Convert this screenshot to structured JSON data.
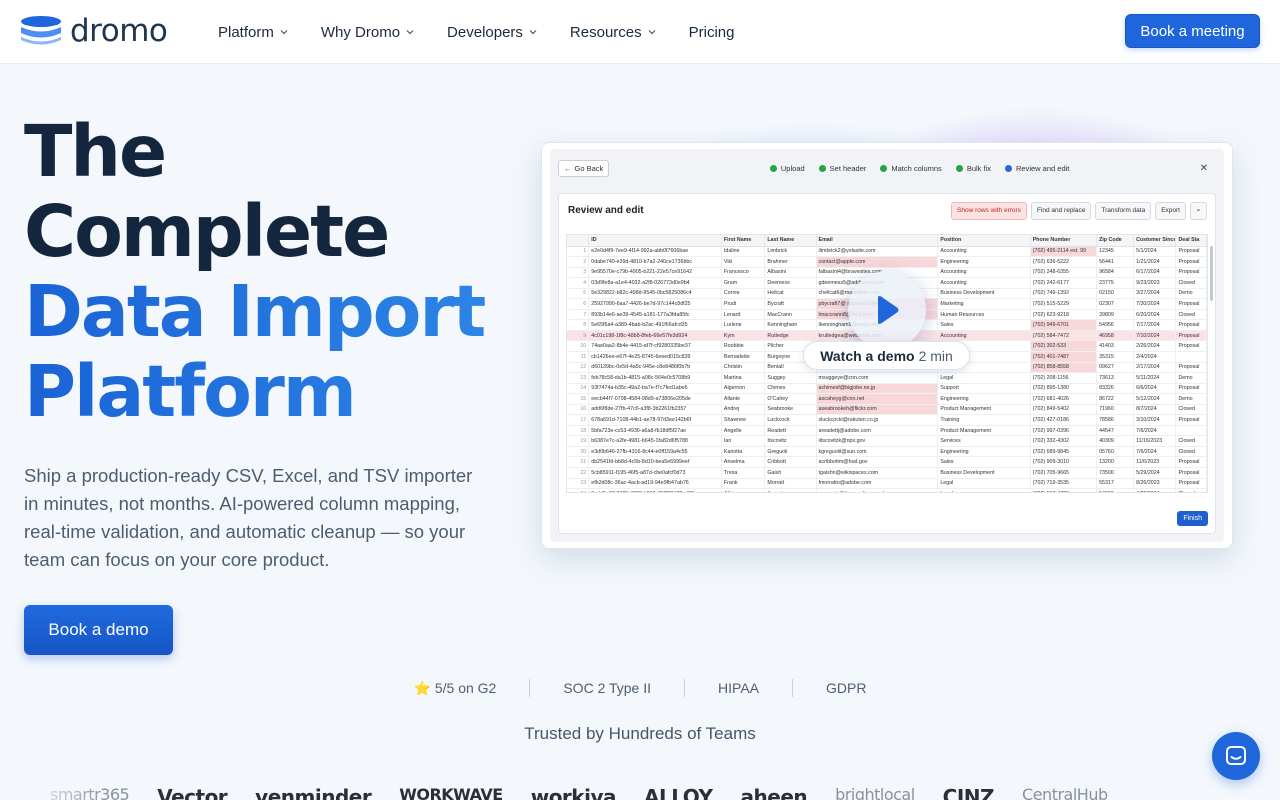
{
  "brand": {
    "name": "dromo"
  },
  "nav": {
    "items": [
      {
        "label": "Platform",
        "has_menu": true
      },
      {
        "label": "Why Dromo",
        "has_menu": true
      },
      {
        "label": "Developers",
        "has_menu": true
      },
      {
        "label": "Resources",
        "has_menu": true
      },
      {
        "label": "Pricing",
        "has_menu": false
      }
    ],
    "cta_label": "Book a meeting"
  },
  "hero": {
    "title_line1": "The",
    "title_line2": "Complete",
    "title_line3": "Data Import",
    "title_line4": "Platform",
    "subtitle": "Ship a production-ready CSV, Excel, and TSV importer in minutes, not months. AI-powered column mapping, real-time validation, and automatic cleanup — so your team can focus on your core product.",
    "cta_label": "Book a demo"
  },
  "demo": {
    "go_back": "Go Back",
    "steps": [
      "Upload",
      "Set header",
      "Match columns",
      "Bulk fix",
      "Review and edit"
    ],
    "panel_title": "Review and edit",
    "tools": [
      "Show rows with errors",
      "Find and replace",
      "Transform data",
      "Export"
    ],
    "columns": [
      "",
      "ID",
      "First Name",
      "Last Name",
      "Email",
      "Position",
      "Phone Number",
      "Zip Code",
      "Customer Since",
      "Deal Sta"
    ],
    "rows": [
      [
        "1",
        "e2e0d4f9-7ee9-4f14-992a-abb0f7606bae",
        "Idaline",
        "Limbrick",
        "ilimbrick2@yolasite.com",
        "Accounting",
        "(702) 495-2114 ext. 99",
        "12345",
        "5/1/2024",
        "Proposal"
      ],
      [
        "2",
        "0dabe740-e39d-4810-b7a2-240ce1736bbc",
        "Viki",
        "Brahmer",
        "contact@apple.com",
        "Engineering",
        "(702) 636-5222",
        "56441",
        "1/21/2024",
        "Proposal"
      ],
      [
        "3",
        "9e95570e-c79b-4905-b221-22e57ce91642",
        "Francesco",
        "Albasini",
        "falbasini4@bravesites.com",
        "Accounting",
        "(702) 248-6355",
        "96584",
        "6/17/2024",
        "Proposal"
      ],
      [
        "4",
        "03d9fe8a-a1e4-4032-a2f8-026773d0e9b4",
        "Gram",
        "Deemess",
        "gdeemess5@addtoany.com",
        "Accounting",
        "(702) 242-6177",
        "23775",
        "9/23/2023",
        "Closed"
      ],
      [
        "5",
        "5e329822-b82c-498d-9545-0bc5825086c4",
        "Cornie",
        "Hellcat",
        "chellcat6@mashable.com",
        "Business Development",
        "(702) 749-1392",
        "02150",
        "3/27/2024",
        "Demo"
      ],
      [
        "6",
        "25927990-6aa7-4426-be7d-97c144c8df25",
        "Prudi",
        "Bycraft",
        "pbycraft7@ sources.com",
        "Marketing",
        "(702) 515-5229",
        "02307",
        "7/30/2024",
        "Proposal"
      ],
      [
        "7",
        "893b14e6-ae39-4545-a181-177a3fda85fc",
        "Lenard",
        "MacCrann",
        "lmaccrann8@ning.com",
        "Human Resources",
        "(702) 623-9218",
        "39809",
        "6/20/2024",
        "Closed"
      ],
      [
        "8",
        "5e65f6a4-a389-4bab-b2ac-491f66afcd35",
        "Lurlene",
        "Kenningham",
        "lkenningham9@ebay.com",
        "Sales",
        "(702) 949-6701",
        "54956",
        "7/17/2024",
        "Proposal"
      ],
      [
        "9",
        "4c01c198-1f8c-48b8-8feb-66e57fe3d924",
        "Kym",
        "Rutledge",
        "krutledgea@webnode.com",
        "Accounting",
        "(702) 584-7472",
        "46958",
        "7/10/2024",
        "Proposal"
      ],
      [
        "10",
        "74ae0aa2-8b4e-4415-af7f-cf9280335be37",
        "Roobbie",
        "Pilcher",
        "rpilcherb@eventbrite.com",
        "Sales",
        "(702) 302-533",
        "41403",
        "2/26/2024",
        "Proposal"
      ],
      [
        "11",
        "cb1426ee-e67f-4e25-8745-6eeed015c839",
        "Bernadette",
        "Burgoyne",
        "bburgoynec@ft.com",
        "Sales",
        "(702) 401-7487",
        "35315",
        "2/4/2024",
        ""
      ],
      [
        "12",
        "d60139bc-0e5d-4a5c-945e-c8e8486f0b7b",
        "Christin",
        "Bentall",
        "cbentalld@t-online.de",
        "Sales",
        "(702) 858-8558",
        "09627",
        "2/17/2024",
        "Proposal"
      ],
      [
        "13",
        "feb78c58-da1b-4815-a08c-564e0c5708b9",
        "Martina",
        "Suggey",
        "msuggeye@cnn.com",
        "Legal",
        "(702) 208-1156",
        "73613",
        "5/11/2024",
        "Demo"
      ],
      [
        "14",
        "93f7474a-b35c-49a2-ba7e-f7c7fed1abe6",
        "Algernon",
        "Chimes",
        "achimesf@bigjobe.ne.jp",
        "Support",
        "(702) 895-1380",
        "83326",
        "6/6/2024",
        "Proposal"
      ],
      [
        "15",
        "eecb44f7-0798-4584-98d9-a73806e205de",
        "Allante",
        "O'Cahey",
        "aocaheyg@cnn.net",
        "Engineering",
        "(702) 681-4026",
        "86722",
        "5/12/2024",
        "Demo"
      ],
      [
        "16",
        "add6f8de-27fb-47c6-a3f8-3b2261fb2357",
        "Andrej",
        "Seabrooke",
        "aseabrookeh@flickr.com",
        "Product Management",
        "(702) 849-5402",
        "71960",
        "8/7/2024",
        "Closed"
      ],
      [
        "17",
        "678a691d-7108-44b1-ae78-97d3ee142b6f",
        "Shawnee",
        "Luckcock",
        "sluckcocki@rakuten.co.jp",
        "Training",
        "(702) 427-0186",
        "78586",
        "3/10/2024",
        "Proposal"
      ],
      [
        "18",
        "5bfa723e-cc53-4936-a6a8-fb18df5f27ae",
        "Angelle",
        "Readett",
        "areadettj@adobe.com",
        "Product Management",
        "(702) 997-0396",
        "44547",
        "7/6/2024",
        ""
      ],
      [
        "19",
        "b6387e7c-a2fe-4981-b645-1fa82d6f5788",
        "Ian",
        "Itscovitz",
        "iitscovitzk@nps.gov",
        "Services",
        "(702) 332-4302",
        "40309",
        "11/16/2023",
        "Closed"
      ],
      [
        "20",
        "e3d0b646-27fb-4316-8c44-e0ff159a4c55",
        "Kariotta",
        "Greguoli",
        "kgreguolil@sun.com",
        "Engineering",
        "(702) 689-9845",
        "05760",
        "7/6/2024",
        "Closed"
      ],
      [
        "21",
        "db2541fd-bb8d-4c5b-8d10-bea5e6999eef",
        "Anselma",
        "Cribbott",
        "acribbottm@hud.gov",
        "Sales",
        "(702) 909-3010",
        "13200",
        "11/6/2023",
        "Proposal"
      ],
      [
        "22",
        "5cb85911-f195-46f5-a87d-cbe0afcf0d73",
        "Tresa",
        "Gaish",
        "tgaishn@wikispaces.com",
        "Business Development",
        "(702) 705-9665",
        "73500",
        "5/29/2024",
        "Proposal"
      ],
      [
        "23",
        "efb2d08c-36ac-4acb-ad19-94e9fb47ab76",
        "Frank",
        "Morratt",
        "fmorratto@adobe.com",
        "Legal",
        "(702) 719-3535",
        "55317",
        "8/26/2023",
        "Proposal"
      ],
      [
        "24",
        "3edd5a92-8425-4808-b860-45722fd78ad20",
        "Albina",
        "Amont",
        "aamontp@timesonline.co.uk",
        "Legal",
        "(702) 518-4729",
        "54526",
        "4/22/2024",
        "Closed"
      ]
    ],
    "finish_label": "Finish",
    "watch_label": "Watch a demo",
    "watch_duration": "2 min"
  },
  "trust": {
    "badges": [
      "⭐ 5/5 on G2",
      "SOC 2 Type II",
      "HIPAA",
      "GDPR"
    ],
    "heading": "Trusted by Hundreds of Teams",
    "logos": [
      "smartr365",
      "Vector",
      "venminder",
      "WORKWAVE",
      "workiva",
      "ALLOY",
      "aheen",
      "brightlocal",
      "CINZ",
      "CentralHub"
    ]
  }
}
